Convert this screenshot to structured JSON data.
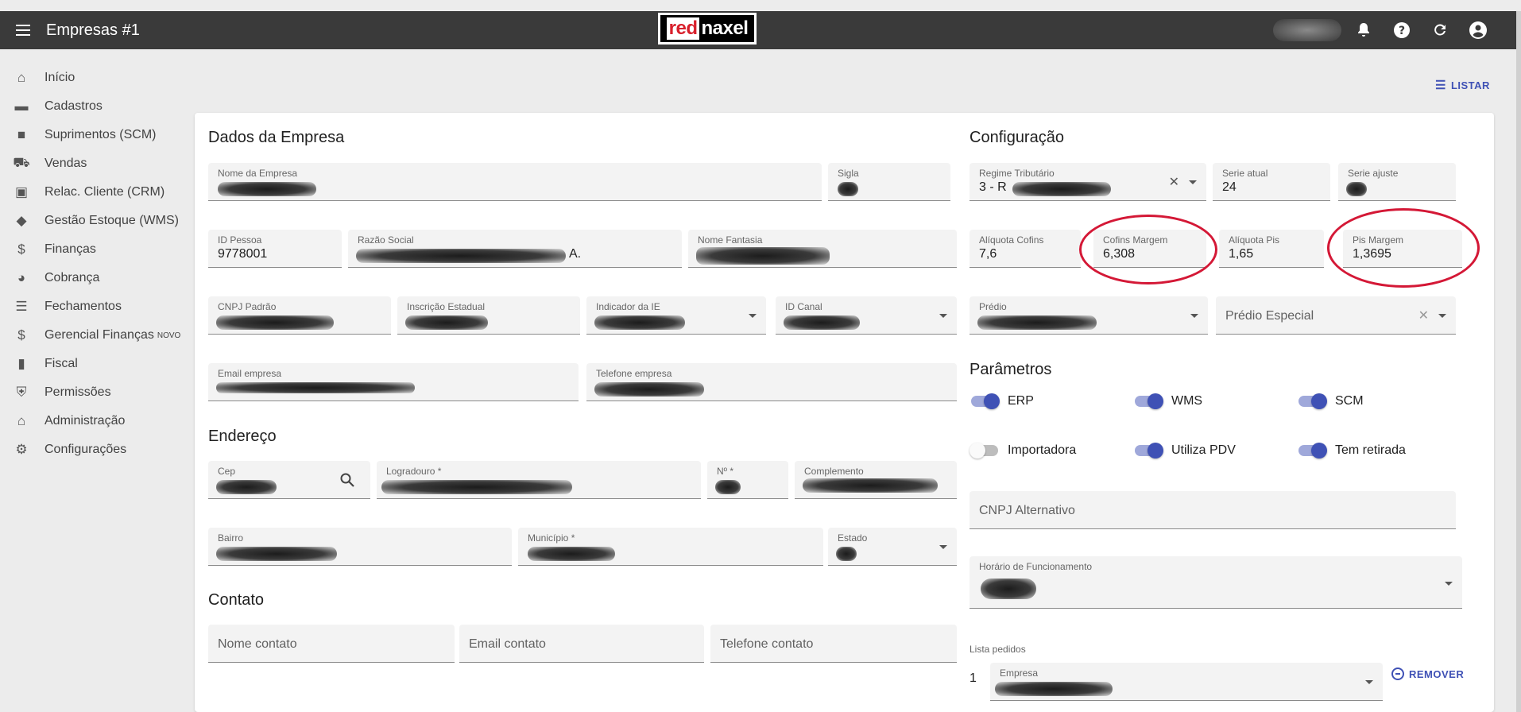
{
  "app": {
    "title": "Empresas #1",
    "logo_red": "red",
    "logo_rest": "naxel",
    "accent": "#3f51b5"
  },
  "sidebar": {
    "items": [
      {
        "label": "Início",
        "icon": "home-icon"
      },
      {
        "label": "Cadastros",
        "icon": "folder-icon"
      },
      {
        "label": "Suprimentos (SCM)",
        "icon": "briefcase-icon"
      },
      {
        "label": "Vendas",
        "icon": "cart-icon"
      },
      {
        "label": "Relac. Cliente (CRM)",
        "icon": "contact-card-icon"
      },
      {
        "label": "Gestão Estoque (WMS)",
        "icon": "directions-icon"
      },
      {
        "label": "Finanças",
        "icon": "dollar-icon"
      },
      {
        "label": "Cobrança",
        "icon": "pie-chart-icon"
      },
      {
        "label": "Fechamentos",
        "icon": "list-icon"
      },
      {
        "label": "Gerencial Finanças",
        "badge": "NOVO",
        "icon": "dollar-icon"
      },
      {
        "label": "Fiscal",
        "icon": "book-icon"
      },
      {
        "label": "Permissões",
        "icon": "shield-icon"
      },
      {
        "label": "Administração",
        "icon": "bank-icon"
      },
      {
        "label": "Configurações",
        "icon": "gear-icon"
      }
    ]
  },
  "actions": {
    "listar": "LISTAR",
    "remover": "REMOVER"
  },
  "dados": {
    "heading": "Dados da Empresa",
    "nome_empresa": "Nome da Empresa",
    "sigla": "Sigla",
    "id_pessoa": {
      "label": "ID Pessoa",
      "value": "9778001"
    },
    "razao_social": {
      "label": "Razão Social",
      "value_tail": "A."
    },
    "nome_fantasia": "Nome Fantasia",
    "cnpj_padrao": "CNPJ Padrão",
    "inscricao_estadual": "Inscrição Estadual",
    "indicador_ie": "Indicador da IE",
    "id_canal": "ID Canal",
    "email_empresa": "Email empresa",
    "telefone_empresa": "Telefone empresa"
  },
  "endereco": {
    "heading": "Endereço",
    "cep": "Cep",
    "logradouro": "Logradouro *",
    "numero": "Nº *",
    "complemento": "Complemento",
    "bairro": "Bairro",
    "municipio": "Município *",
    "estado": "Estado"
  },
  "contato": {
    "heading": "Contato",
    "nome_contato": "Nome contato",
    "email_contato": "Email contato",
    "telefone_contato": "Telefone contato"
  },
  "configuracao": {
    "heading": "Configuração",
    "regime_tributario": {
      "label": "Regime Tributário",
      "value": "3 - R"
    },
    "serie_atual": {
      "label": "Serie atual",
      "value": "24"
    },
    "serie_ajuste": {
      "label": "Serie ajuste"
    },
    "aliquota_cofins": {
      "label": "Alíquota Cofins",
      "value": "7,6"
    },
    "cofins_margem": {
      "label": "Cofins Margem",
      "value": "6,308"
    },
    "aliquota_pis": {
      "label": "Alíquota Pis",
      "value": "1,65"
    },
    "pis_margem": {
      "label": "Pis Margem",
      "value": "1,3695"
    },
    "predio": {
      "label": "Prédio"
    },
    "predio_especial": {
      "placeholder": "Prédio Especial"
    },
    "highlight_color": "#d41836"
  },
  "parametros": {
    "heading": "Parâmetros",
    "toggles": [
      {
        "label": "ERP",
        "on": true
      },
      {
        "label": "WMS",
        "on": true
      },
      {
        "label": "SCM",
        "on": true
      },
      {
        "label": "Importadora",
        "on": false
      },
      {
        "label": "Utiliza PDV",
        "on": true
      },
      {
        "label": "Tem retirada",
        "on": true
      }
    ],
    "cnpj_alternativo": "CNPJ Alternativo",
    "horario_funcionamento": "Horário de Funcionamento",
    "lista_pedidos": "Lista pedidos",
    "pedido_index": "1",
    "empresa": "Empresa"
  }
}
